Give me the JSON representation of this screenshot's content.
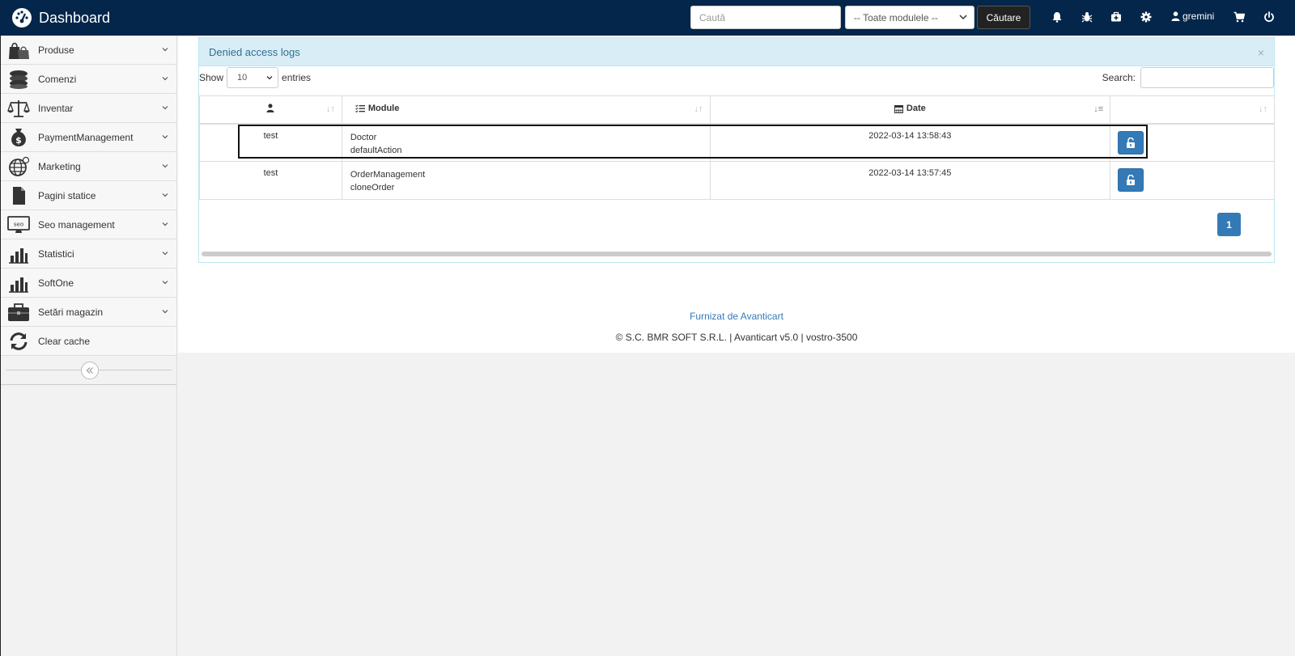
{
  "app": {
    "title": "Dashboard"
  },
  "topbar": {
    "search_placeholder": "Caută",
    "module_select": "-- Toate modulele --",
    "search_button": "Căutare",
    "username": "gremini"
  },
  "sidebar": {
    "items": [
      {
        "label": "Produse",
        "icon": "shopping-bags-icon"
      },
      {
        "label": "Comenzi",
        "icon": "coins-icon"
      },
      {
        "label": "Inventar",
        "icon": "scale-icon"
      },
      {
        "label": "PaymentManagement",
        "icon": "money-bag-icon"
      },
      {
        "label": "Marketing",
        "icon": "globe-icon"
      },
      {
        "label": "Pagini statice",
        "icon": "file-icon"
      },
      {
        "label": "Seo management",
        "icon": "seo-monitor-icon"
      },
      {
        "label": "Statistici",
        "icon": "bar-chart-icon"
      },
      {
        "label": "SoftOne",
        "icon": "bar-chart-icon"
      },
      {
        "label": "Setări magazin",
        "icon": "briefcase-icon"
      },
      {
        "label": "Clear cache",
        "icon": "refresh-icon"
      }
    ]
  },
  "panel": {
    "title": "Denied access logs",
    "close": "×",
    "show_label": "Show",
    "entries_value": "10",
    "entries_label": "entries",
    "search_label": "Search:"
  },
  "table": {
    "headers": {
      "module": "Module",
      "date": "Date"
    },
    "rows": [
      {
        "user": "test",
        "module": "Doctor",
        "action": "defaultAction",
        "date": "2022-03-14 13:58:43"
      },
      {
        "user": "test",
        "module": "OrderManagement",
        "action": "cloneOrder",
        "date": "2022-03-14 13:57:45"
      }
    ]
  },
  "pagination": {
    "current": "1"
  },
  "footer": {
    "link": "Furnizat de Avanticart",
    "copyright": "© S.C. BMR SOFT S.R.L. | Avanticart v5.0 | vostro-3500"
  },
  "colors": {
    "topbar": "#03264a",
    "primary": "#337ab7",
    "panel_heading": "#d9edf7"
  }
}
